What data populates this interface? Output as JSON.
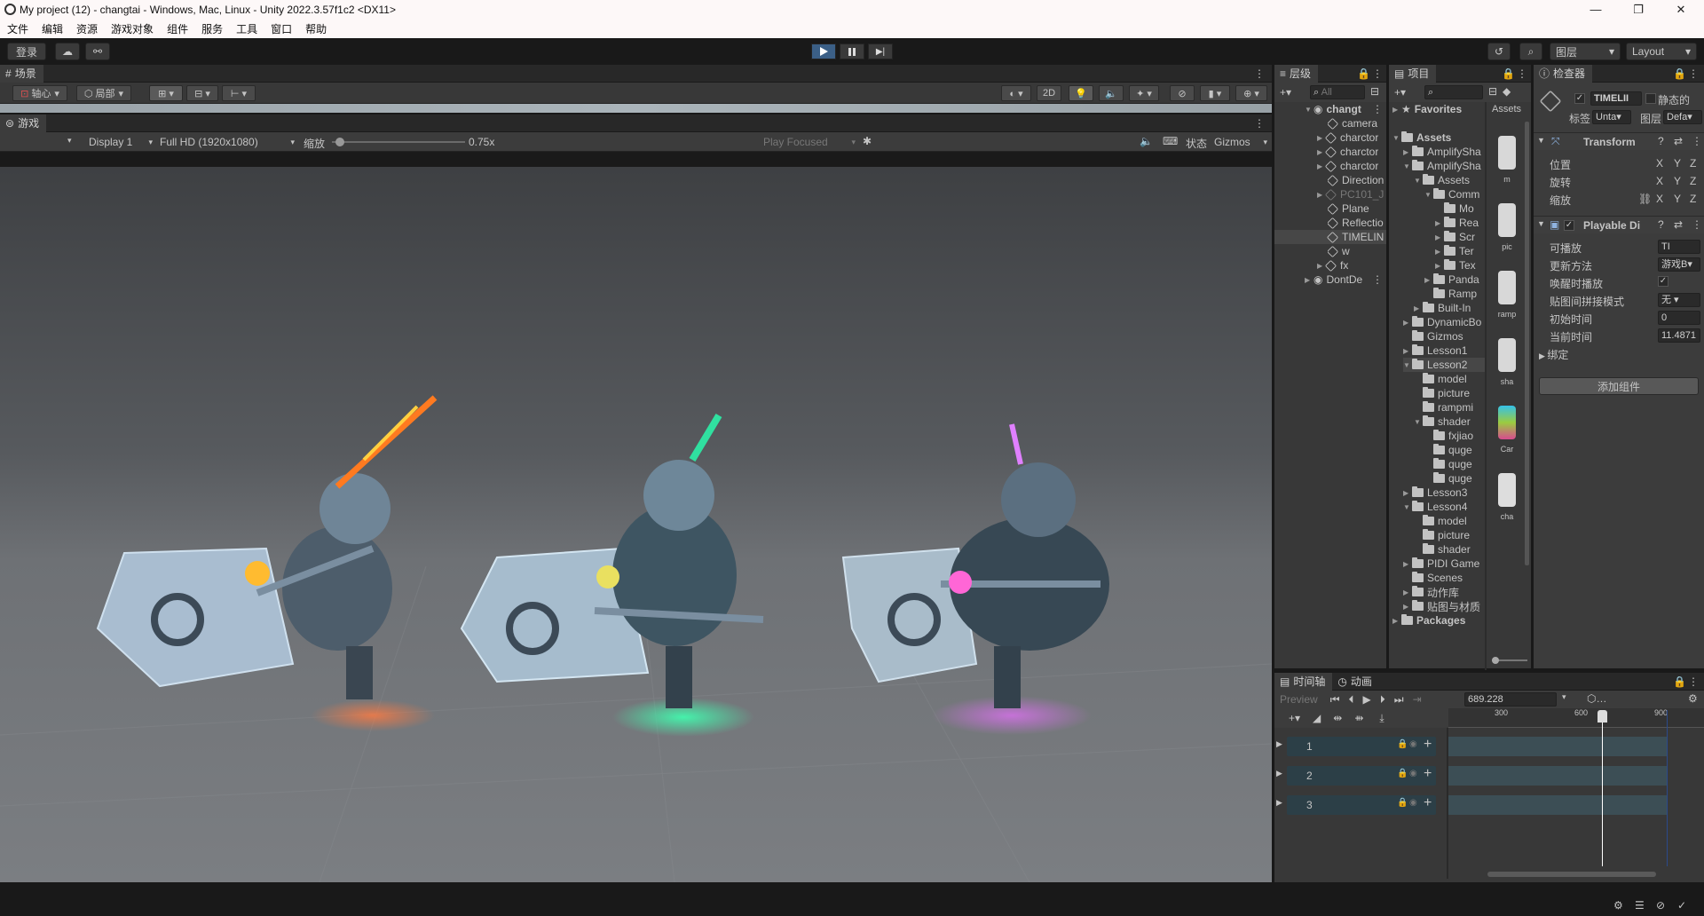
{
  "window": {
    "title": "My project (12) - changtai - Windows, Mac, Linux - Unity 2022.3.57f1c2 <DX11>",
    "controls": {
      "minimize": "—",
      "maximize": "❐",
      "close": "✕"
    }
  },
  "menu": [
    "文件",
    "编辑",
    "资源",
    "游戏对象",
    "组件",
    "服务",
    "工具",
    "窗口",
    "帮助"
  ],
  "toolbar": {
    "login": "登录",
    "layers": "图层",
    "layout": "Layout"
  },
  "scene": {
    "tab": "场景",
    "pivot": "轴心",
    "local": "局部",
    "mode_2d": "2D"
  },
  "game": {
    "tab": "游戏",
    "display": "Display 1",
    "resolution": "Full HD (1920x1080)",
    "scale_label": "缩放",
    "scale_value": "0.75x",
    "scale_fraction": 0.06,
    "play_focused": "Play Focused",
    "stats": "状态",
    "gizmos": "Gizmos"
  },
  "hierarchy": {
    "tab": "层级",
    "search_placeholder": "All",
    "items": [
      "changt",
      "camera",
      "charctor",
      "charctor",
      "charctor",
      "Direction",
      "PC101_J",
      "Plane",
      "Reflectio",
      "TIMELIN",
      "w",
      "fx",
      "DontDe"
    ]
  },
  "project": {
    "tab": "项目",
    "favorites": "Favorites",
    "breadcrumb": "Assets",
    "tree": [
      "Assets",
      "AmplifySha",
      "AmplifySha",
      "Assets",
      "Comm",
      "Mo",
      "Rea",
      "Scr",
      "Ter",
      "Tex",
      "Panda",
      "Ramp",
      "Built-In",
      "DynamicBo",
      "Gizmos",
      "Lesson1",
      "Lesson2",
      "model",
      "picture",
      "rampmi",
      "shader",
      "fxjiao",
      "quge",
      "quge",
      "quge",
      "Lesson3",
      "Lesson4",
      "model",
      "picture",
      "shader",
      "PIDI Game",
      "Scenes",
      "动作库",
      "贴图与材质",
      "Packages"
    ],
    "thumbs": [
      "m",
      "pic",
      "ramp",
      "sha",
      "Car",
      "cha"
    ]
  },
  "inspector": {
    "tab": "检查器",
    "object_name": "TIMELII",
    "static": "静态的",
    "tag_label": "标签",
    "tag_value": "Unta",
    "layer_label": "图层",
    "layer_value": "Defa",
    "transform": {
      "title": "Transform",
      "position": "位置",
      "rotation": "旋转",
      "scale": "缩放",
      "x": "X",
      "y": "Y",
      "z": "Z"
    },
    "playable": {
      "title": "Playable Di",
      "playable_label": "可播放",
      "playable_value": "TI",
      "update_label": "更新方法",
      "update_value": "游戏B",
      "wake_label": "唤醒时播放",
      "wrap_label": "贴图间拼接模式",
      "wrap_value": "无",
      "init_label": "初始时间",
      "init_value": "0",
      "current_label": "当前时间",
      "current_value": "11.4871",
      "bindings": "绑定"
    },
    "add_component": "添加组件"
  },
  "timeline": {
    "tab": "时间轴",
    "anim_tab": "动画",
    "preview": "Preview",
    "frame": "689.228",
    "ruler": [
      "300",
      "600",
      "900"
    ],
    "tracks": [
      "1",
      "2",
      "3"
    ],
    "playhead_fraction": 0.6
  },
  "colors": {
    "accent": "#3b5f86",
    "panel": "#383838",
    "dark": "#191919",
    "track": "#2c3f47"
  }
}
